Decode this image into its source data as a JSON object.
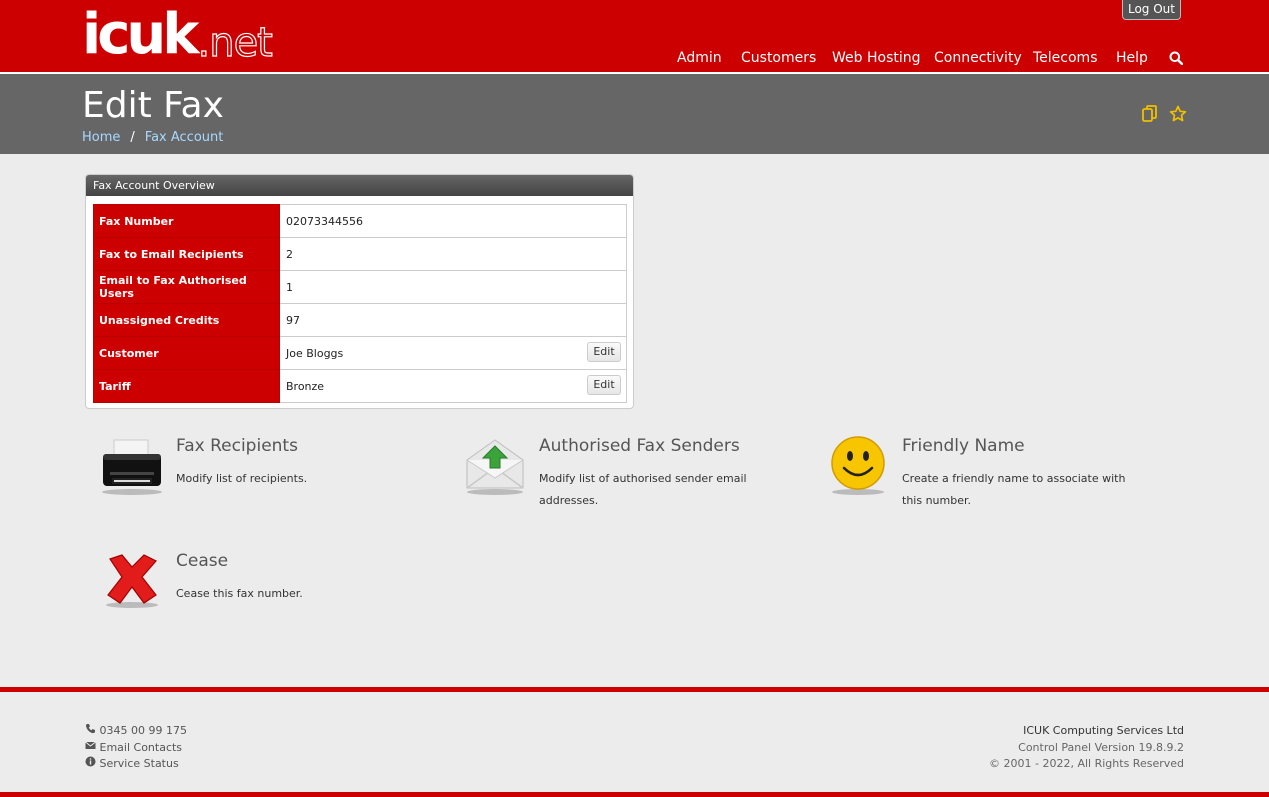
{
  "header": {
    "logo_main": "icuk",
    "logo_suffix": ".net",
    "logout_label": "Log Out",
    "nav": [
      "Admin",
      "Customers",
      "Web Hosting",
      "Connectivity",
      "Telecoms",
      "Help"
    ],
    "search_icon": "search-icon"
  },
  "page": {
    "title": "Edit Fax",
    "breadcrumb": [
      "Home",
      "Fax Account"
    ],
    "icons": [
      "copy-icon",
      "star-icon"
    ]
  },
  "overview": {
    "heading": "Fax Account Overview",
    "rows": [
      {
        "label": "Fax Number",
        "value": "02073344556"
      },
      {
        "label": "Fax to Email Recipients",
        "value": "2"
      },
      {
        "label": "Email to Fax Authorised Users",
        "value": "1"
      },
      {
        "label": "Unassigned Credits",
        "value": "97"
      },
      {
        "label": "Customer",
        "value": "Joe Bloggs",
        "edit": "Edit"
      },
      {
        "label": "Tariff",
        "value": "Bronze",
        "edit": "Edit"
      }
    ]
  },
  "actions": [
    {
      "title": "Fax Recipients",
      "desc": "Modify list of recipients.",
      "icon": "printer-icon"
    },
    {
      "title": "Authorised Fax Senders",
      "desc": "Modify list of authorised sender email addresses.",
      "icon": "envelope-upload-icon"
    },
    {
      "title": "Friendly Name",
      "desc": "Create a friendly name to associate with this number.",
      "icon": "smiley-icon"
    },
    {
      "title": "Cease",
      "desc": "Cease this fax number.",
      "icon": "red-cross-icon"
    }
  ],
  "footer": {
    "phone": "0345 00 99 175",
    "email_contacts": "Email Contacts",
    "service_status": "Service Status",
    "company": "ICUK Computing Services Ltd",
    "version": "Control Panel Version 19.8.9.2",
    "copyright": "© 2001 - 2022, All Rights Reserved"
  },
  "colors": {
    "brand_red": "#cc0000",
    "title_band": "#666666",
    "link_blue": "#a8d8ff",
    "icon_gold": "#f0c000"
  }
}
